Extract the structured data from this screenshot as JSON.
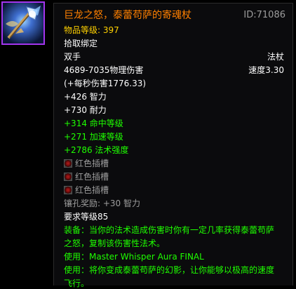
{
  "item": {
    "name": "巨龙之怒，泰蕾苟萨的寄魂杖",
    "id_label": "ID:71086",
    "item_level": "物品等级: 397",
    "binding": "拾取绑定",
    "slot": "双手",
    "type": "法杖",
    "damage": "4689-7035物理伤害",
    "speed": "速度3.30",
    "dps": "(+每秒伤害1776.33)",
    "stats": [
      "+426 智力",
      "+730 耐力"
    ],
    "green_stats": [
      "+314 命中等级",
      "+271 加速等级",
      "+2786 法术强度"
    ],
    "sockets": [
      "红色插槽",
      "红色插槽",
      "红色插槽"
    ],
    "socket_bonus": "镶孔奖励: +30 智力",
    "required_level": "要求等级85",
    "effects": [
      "装备：当你的法术造成伤害时你有一定几率获得泰蕾苟萨",
      "之怒，复制该伤害性法术。",
      "使用：Master Whisper Aura FINAL",
      "使用：将你变成泰蕾苟萨的幻影，让你能够以极高的速度",
      "飞行。"
    ]
  },
  "colors": {
    "legendary": "#ff8000",
    "item_level": "#ffd100",
    "bonus_green": "#1eff00",
    "grey": "#9d9d9d",
    "icon_border": "#a335ee"
  },
  "icon": "staff-icon"
}
